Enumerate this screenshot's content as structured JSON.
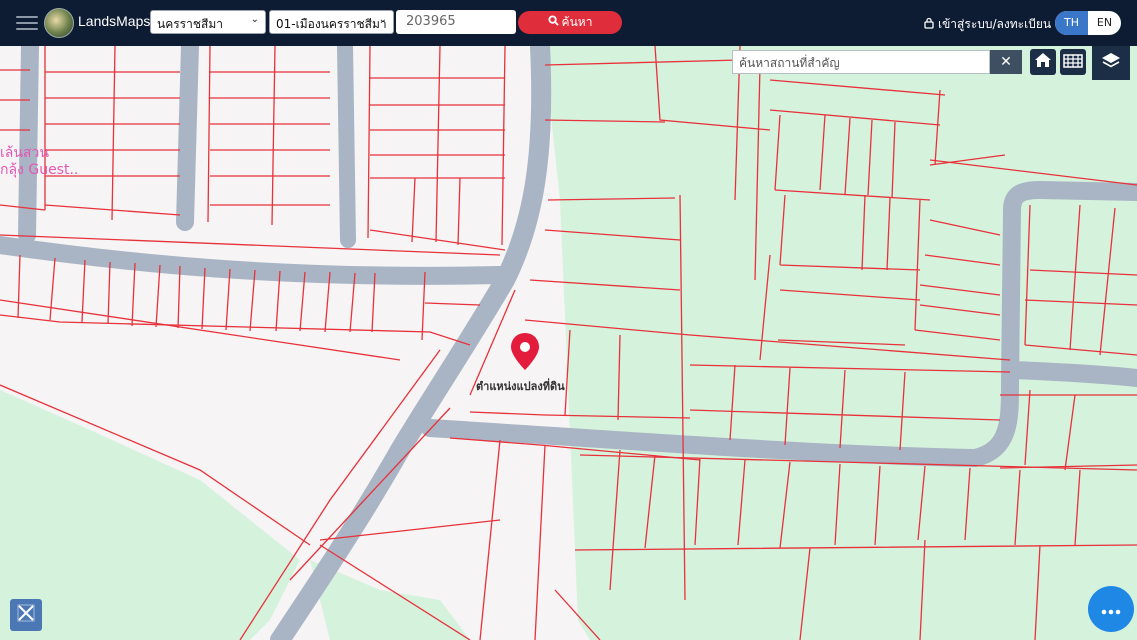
{
  "header": {
    "brand": "LandsMaps",
    "province": "นครราชสีมา",
    "district": "01-เมืองนครราชสีมา",
    "parcel_value": "203965",
    "search_label": "ค้นหา",
    "login_label": "เข้าสู่ระบบ/ลงทะเบียน",
    "lang_th": "TH",
    "lang_en": "EN"
  },
  "map": {
    "place_search_placeholder": "ค้นหาสถานที่สำคัญ",
    "marker_label": "ตำแหน่งแปลงที่ดิน",
    "poi_label_line1": "เล้นสวน",
    "poi_label_line2": "กลุ้ง Guest..",
    "icons": [
      "home-icon",
      "grid-icon",
      "layers-icon",
      "ruler-icon",
      "more-icon"
    ],
    "colors": {
      "parcel_line": "#e8313a",
      "road": "#a9b4c4",
      "green_area": "#d4f3dc",
      "marker": "#e31b3c",
      "header_bg": "#0d1c33"
    }
  }
}
